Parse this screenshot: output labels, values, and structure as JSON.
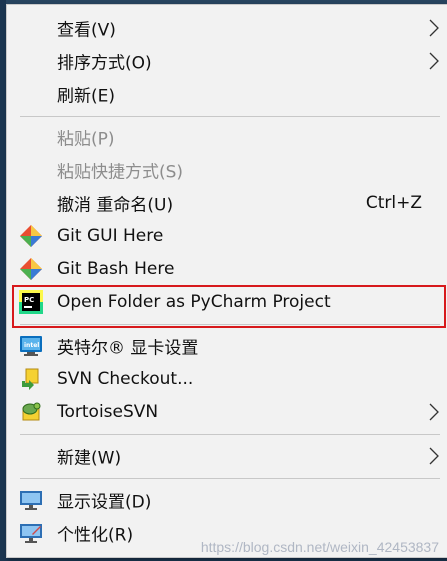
{
  "menu": {
    "items": [
      {
        "label": "查看(V)"
      },
      {
        "label": "排序方式(O)"
      },
      {
        "label": "刷新(E)"
      },
      {
        "label": "粘贴(P)"
      },
      {
        "label": "粘贴快捷方式(S)"
      },
      {
        "label": "撤消 重命名(U)",
        "shortcut": "Ctrl+Z"
      },
      {
        "label": "Git GUI Here"
      },
      {
        "label": "Git Bash Here"
      },
      {
        "label": "Open Folder as PyCharm Project"
      },
      {
        "label": "英特尔® 显卡设置"
      },
      {
        "label": "SVN Checkout..."
      },
      {
        "label": "TortoiseSVN"
      },
      {
        "label": "新建(W)"
      },
      {
        "label": "显示设置(D)"
      },
      {
        "label": "个性化(R)"
      }
    ]
  },
  "watermark": "https://blog.csdn.net/weixin_42453837",
  "colors": {
    "menu_bg": "#f2f2f2",
    "highlight_border": "#d7191c",
    "disabled_text": "#8d8d8d"
  },
  "icons": {
    "git_gui": "git-gui-icon",
    "git_bash": "git-bash-icon",
    "pycharm": "pycharm-icon",
    "intel": "intel-graphics-icon",
    "svn_checkout": "svn-checkout-icon",
    "tortoise": "tortoisesvn-icon",
    "display": "display-settings-icon",
    "personalize": "personalize-icon",
    "chevron": "chevron-right-icon"
  }
}
